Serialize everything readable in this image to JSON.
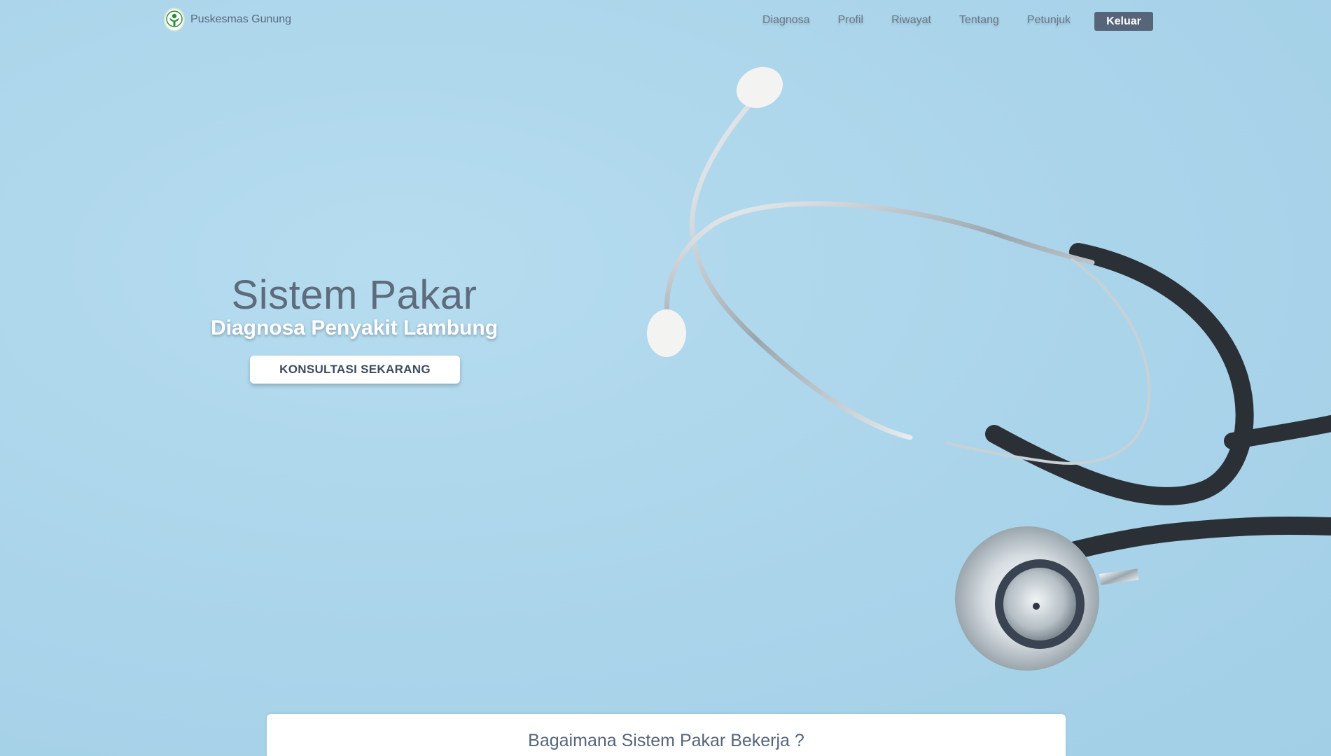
{
  "navbar": {
    "brand_name": "Puskesmas Gunung",
    "links": [
      {
        "label": "Diagnosa"
      },
      {
        "label": "Profil"
      },
      {
        "label": "Riwayat"
      },
      {
        "label": "Tentang"
      },
      {
        "label": "Petunjuk"
      }
    ],
    "logout_label": "Keluar"
  },
  "hero": {
    "title": "Sistem Pakar",
    "subtitle": "Diagnosa Penyakit Lambung",
    "cta_label": "KONSULTASI SEKARANG"
  },
  "info_card": {
    "title": "Bagaimana Sistem Pakar Bekerja ?"
  },
  "colors": {
    "background": "#aad4ea",
    "logout_button": "#56657a",
    "title_text": "#5d6b7d"
  }
}
